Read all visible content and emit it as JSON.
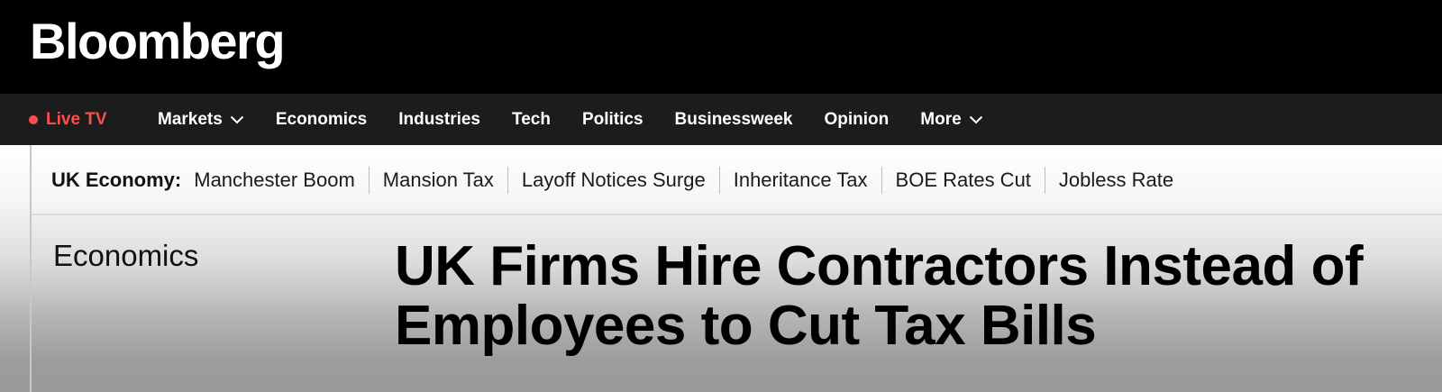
{
  "masthead": {
    "logo": "Bloomberg"
  },
  "nav": {
    "live": "Live TV",
    "items": [
      {
        "label": "Markets",
        "has_dropdown": true
      },
      {
        "label": "Economics",
        "has_dropdown": false
      },
      {
        "label": "Industries",
        "has_dropdown": false
      },
      {
        "label": "Tech",
        "has_dropdown": false
      },
      {
        "label": "Politics",
        "has_dropdown": false
      },
      {
        "label": "Businessweek",
        "has_dropdown": false
      },
      {
        "label": "Opinion",
        "has_dropdown": false
      },
      {
        "label": "More",
        "has_dropdown": true
      }
    ]
  },
  "topics": {
    "label": "UK Economy:",
    "links": [
      "Manchester Boom",
      "Mansion Tax",
      "Layoff Notices Surge",
      "Inheritance Tax",
      "BOE Rates Cut",
      "Jobless Rate"
    ]
  },
  "article": {
    "section": "Economics",
    "headline": "UK Firms Hire Contractors Instead of Employees to Cut Tax Bills"
  },
  "colors": {
    "masthead_bg": "#000000",
    "nav_bg": "#1c1c1c",
    "live_accent": "#ff4d4d"
  },
  "icons": {
    "live": "live-dot-icon",
    "dropdown": "chevron-down-icon"
  }
}
